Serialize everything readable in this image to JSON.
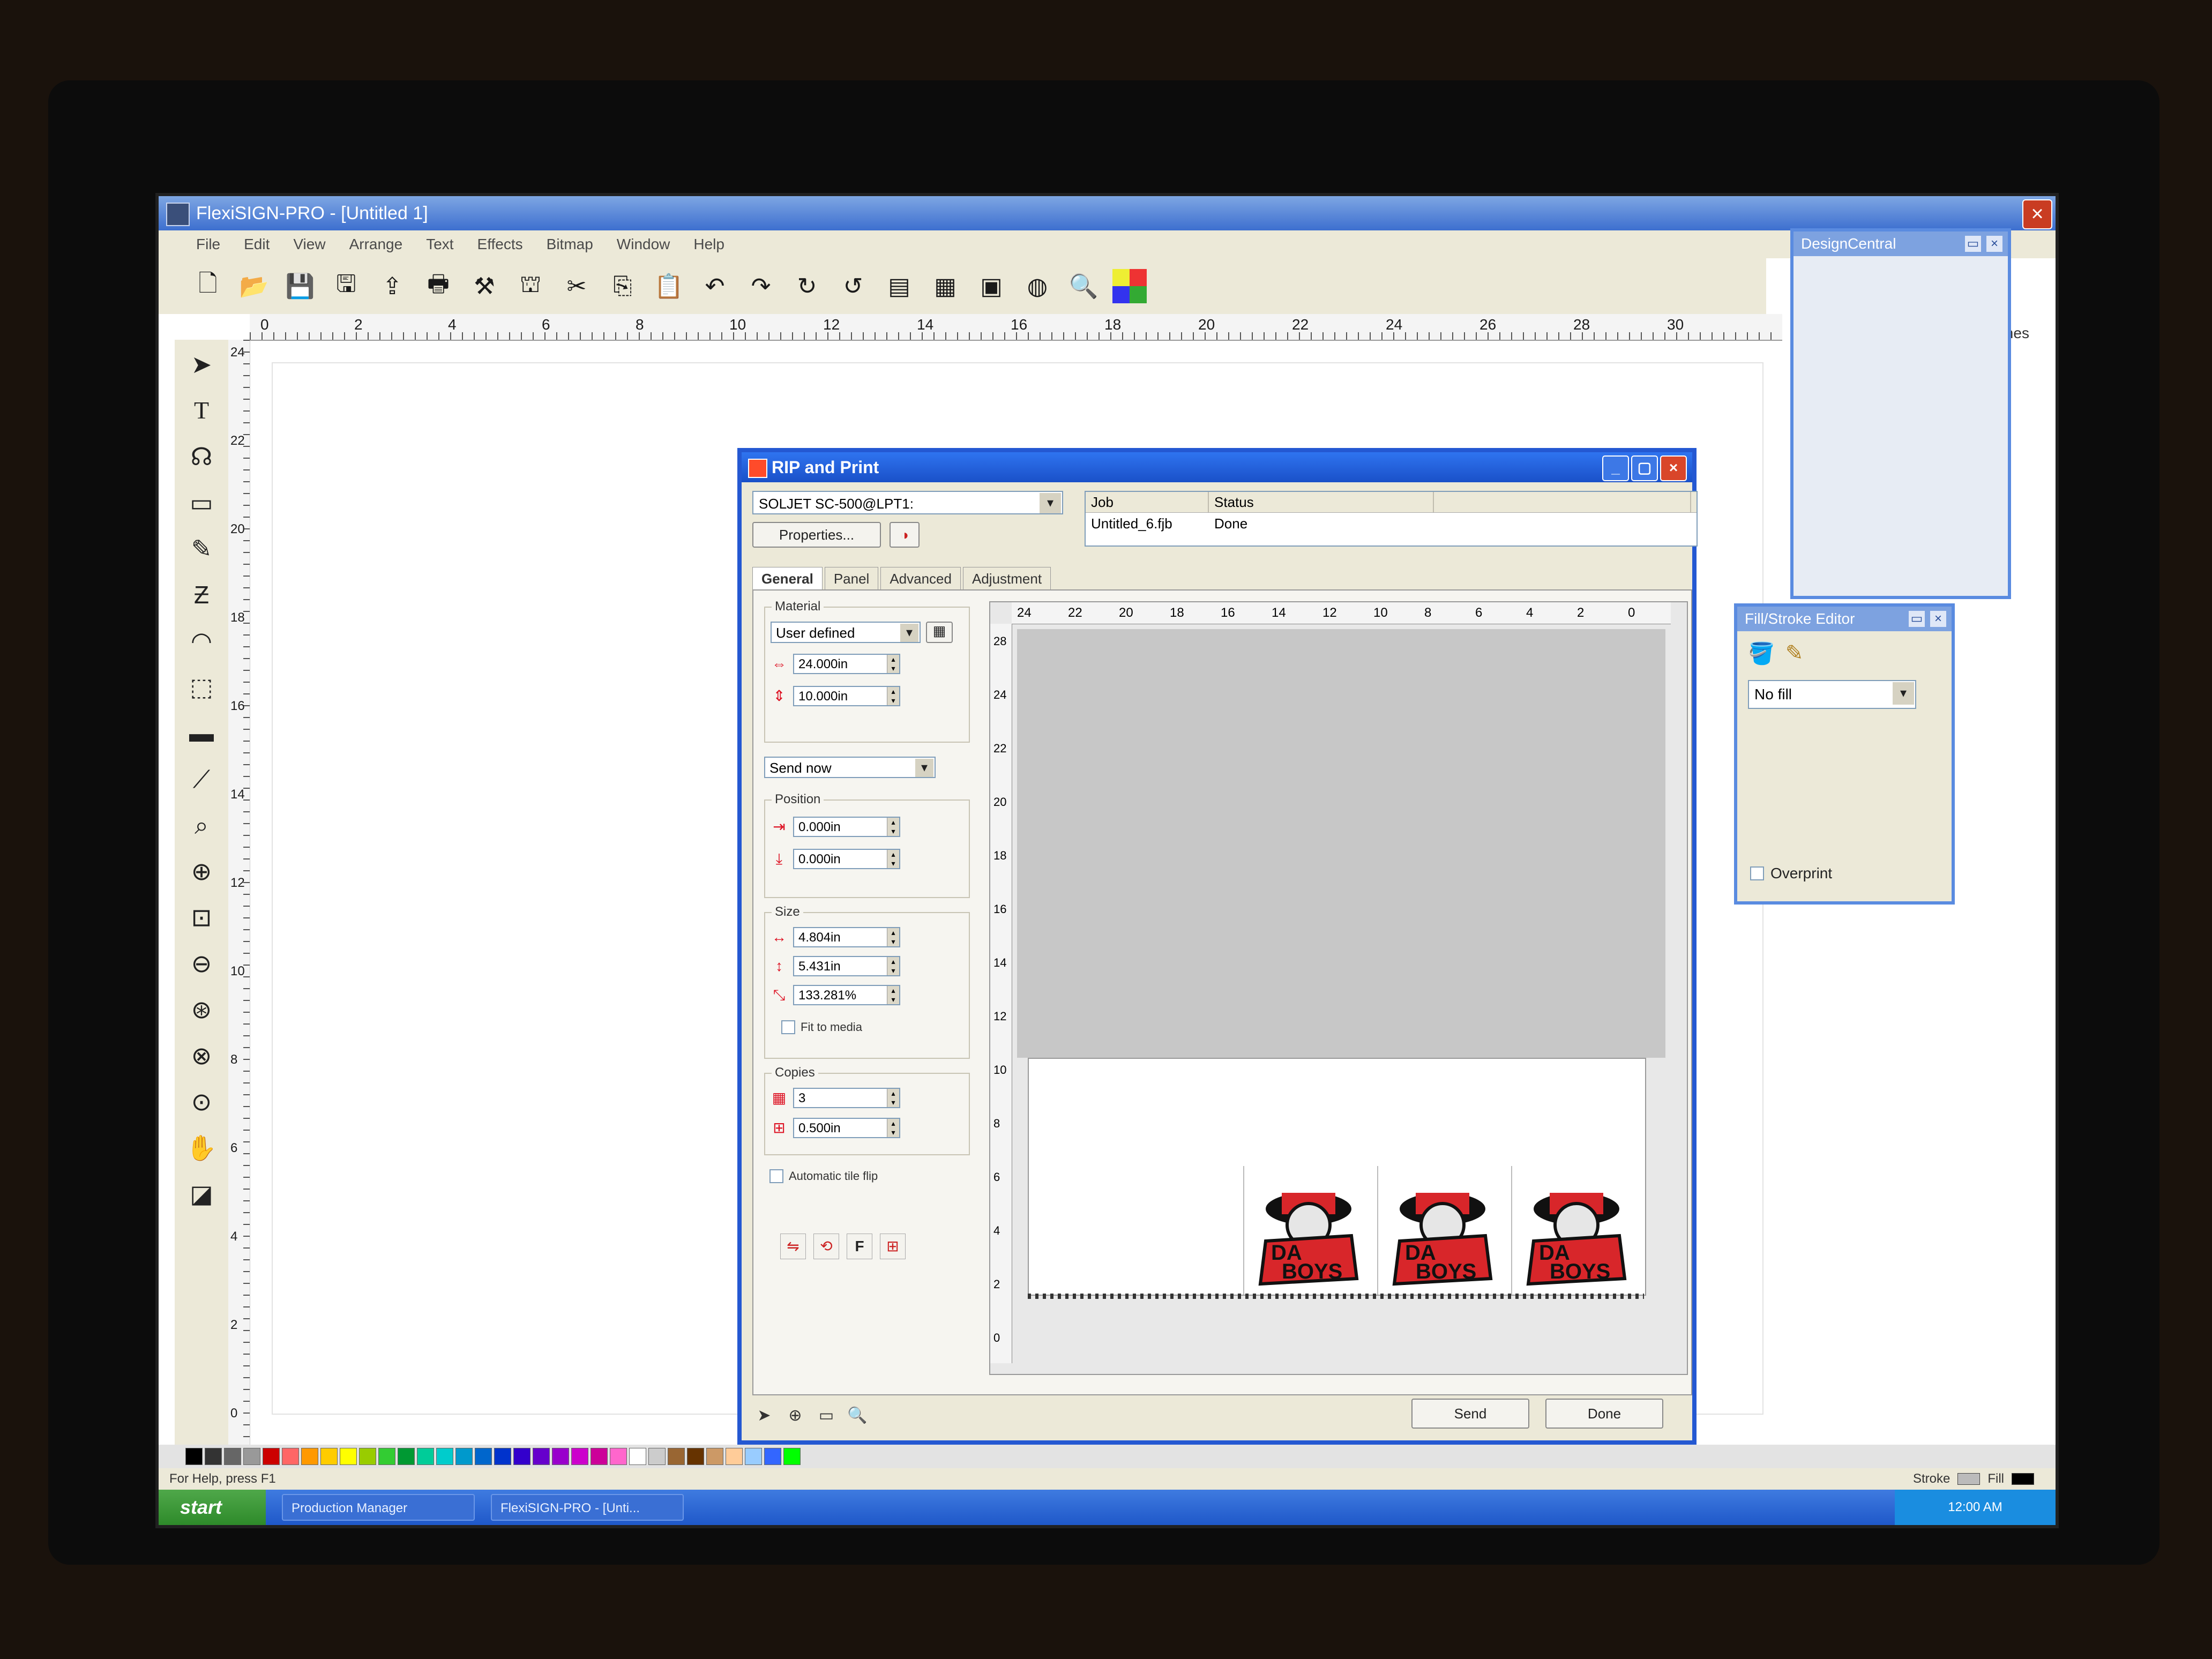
{
  "app": {
    "title": "FlexiSIGN-PRO - [Untitled 1]",
    "menu": [
      "File",
      "Edit",
      "View",
      "Arrange",
      "Text",
      "Effects",
      "Bitmap",
      "Window",
      "Help"
    ]
  },
  "toolbar_icons": [
    "new-icon",
    "open-icon",
    "save-icon",
    "save-all-icon",
    "import-icon",
    "print-icon",
    "cut-plot-icon",
    "rip-icon",
    "cut-icon",
    "copy-icon",
    "paste-icon",
    "undo-icon",
    "redo-icon",
    "redo-alt-icon",
    "redo-more-icon",
    "design-central-icon",
    "fill-stroke-icon",
    "production-icon",
    "color-icon",
    "zoom-icon",
    "swatch-icon"
  ],
  "ruler": {
    "h_labels": [
      "0",
      "2",
      "4",
      "6",
      "8",
      "10",
      "12",
      "14",
      "16",
      "18",
      "20",
      "22",
      "24",
      "26",
      "28",
      "30"
    ],
    "v_labels": [
      "24",
      "22",
      "20",
      "18",
      "16",
      "14",
      "12",
      "10",
      "8",
      "6",
      "4",
      "2",
      "0"
    ],
    "units": "inches"
  },
  "design_central": {
    "title": "DesignCentral"
  },
  "fill_stroke": {
    "title": "Fill/Stroke Editor",
    "fill_value": "No fill",
    "overprint_label": "Overprint"
  },
  "rip": {
    "title": "RIP and Print",
    "printer": "SOLJET SC-500@LPT1:",
    "properties_label": "Properties...",
    "job_columns": [
      "Job",
      "Status"
    ],
    "jobs": [
      {
        "job": "Untitled_6.fjb",
        "status": "Done"
      }
    ],
    "tabs": [
      "General",
      "Panel",
      "Advanced",
      "Adjustment"
    ],
    "material": {
      "label": "Material",
      "value": "User defined",
      "width": "24.000in",
      "height": "10.000in"
    },
    "send_mode": "Send now",
    "position": {
      "label": "Position",
      "x": "0.000in",
      "y": "0.000in"
    },
    "size": {
      "label": "Size",
      "width": "4.804in",
      "height": "5.431in",
      "scale": "133.281%",
      "fit_label": "Fit to media"
    },
    "copies": {
      "label": "Copies",
      "count": "3",
      "spacing": "0.500in"
    },
    "auto_tile_label": "Automatic tile flip",
    "preview_h_labels": [
      "24",
      "22",
      "20",
      "18",
      "16",
      "14",
      "12",
      "10",
      "8",
      "6",
      "4",
      "2",
      "0"
    ],
    "preview_v_labels": [
      "28",
      "24",
      "22",
      "20",
      "18",
      "16",
      "14",
      "12",
      "10",
      "8",
      "6",
      "4",
      "2",
      "0"
    ],
    "logo_text_1": "DA",
    "logo_text_2": "BOYS",
    "send_label": "Send",
    "done_label": "Done"
  },
  "status": {
    "help": "For Help, press F1",
    "stroke_label": "Stroke",
    "fill_label": "Fill"
  },
  "taskbar": {
    "start": "start",
    "items": [
      "Production Manager",
      "FlexiSIGN-PRO - [Unti..."
    ],
    "clock": "12:00 AM"
  },
  "colors": {
    "xp_blue": "#2458d2",
    "logo_red": "#d8262a",
    "logo_black": "#111111"
  },
  "palette": [
    "#000000",
    "#333333",
    "#666666",
    "#999999",
    "#cc0000",
    "#ff6666",
    "#ff9900",
    "#ffcc00",
    "#ffff00",
    "#99cc00",
    "#33cc33",
    "#009933",
    "#00cc99",
    "#00cccc",
    "#0099cc",
    "#0066cc",
    "#0033cc",
    "#3300cc",
    "#6600cc",
    "#9900cc",
    "#cc00cc",
    "#cc0099",
    "#ff66cc",
    "#ffffff",
    "#cccccc",
    "#996633",
    "#663300",
    "#cc9966",
    "#ffcc99",
    "#99ccff",
    "#3366ff",
    "#00ff00"
  ]
}
